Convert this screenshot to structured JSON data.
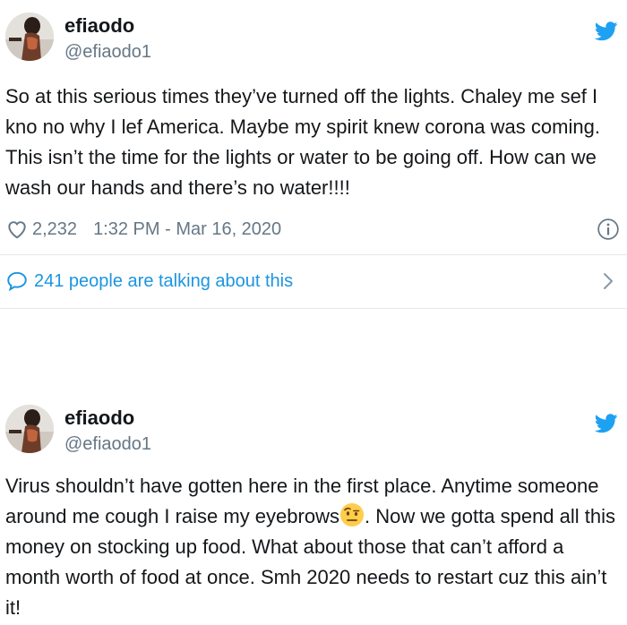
{
  "tweets": [
    {
      "display_name": "efiaodo",
      "handle": "@efiaodo1",
      "text": "So at this serious times they’ve turned off the lights. Chaley me sef I kno no why I lef America. Maybe my spirit knew corona was coming. This isn’t the time for the lights or water to be going off. How can we wash our hands and there’s no water!!!!",
      "likes": "2,232",
      "timestamp": "1:32 PM - Mar 16, 2020",
      "talking": "241 people are talking about this"
    },
    {
      "display_name": "efiaodo",
      "handle": "@efiaodo1",
      "text_before_emoji": "Virus shouldn’t have gotten here in the first place. Anytime someone around me cough I raise my eyebrows",
      "emoji": "face-with-raised-eyebrow",
      "text_after_emoji": ". Now we gotta spend all this money on stocking up food. What about those that can’t afford a month worth of food at once. Smh 2020 needs to restart cuz this ain’t it!"
    }
  ],
  "icons": {
    "brand": "twitter-bird-icon",
    "like": "heart-icon",
    "info": "info-icon",
    "replies": "speech-bubble-icon",
    "more": "chevron-right-icon"
  },
  "colors": {
    "brand_blue": "#1da1f2",
    "link_blue": "#1b95e0",
    "secondary_text": "#657786",
    "primary_text": "#14171a",
    "divider": "#e1e8ed"
  }
}
